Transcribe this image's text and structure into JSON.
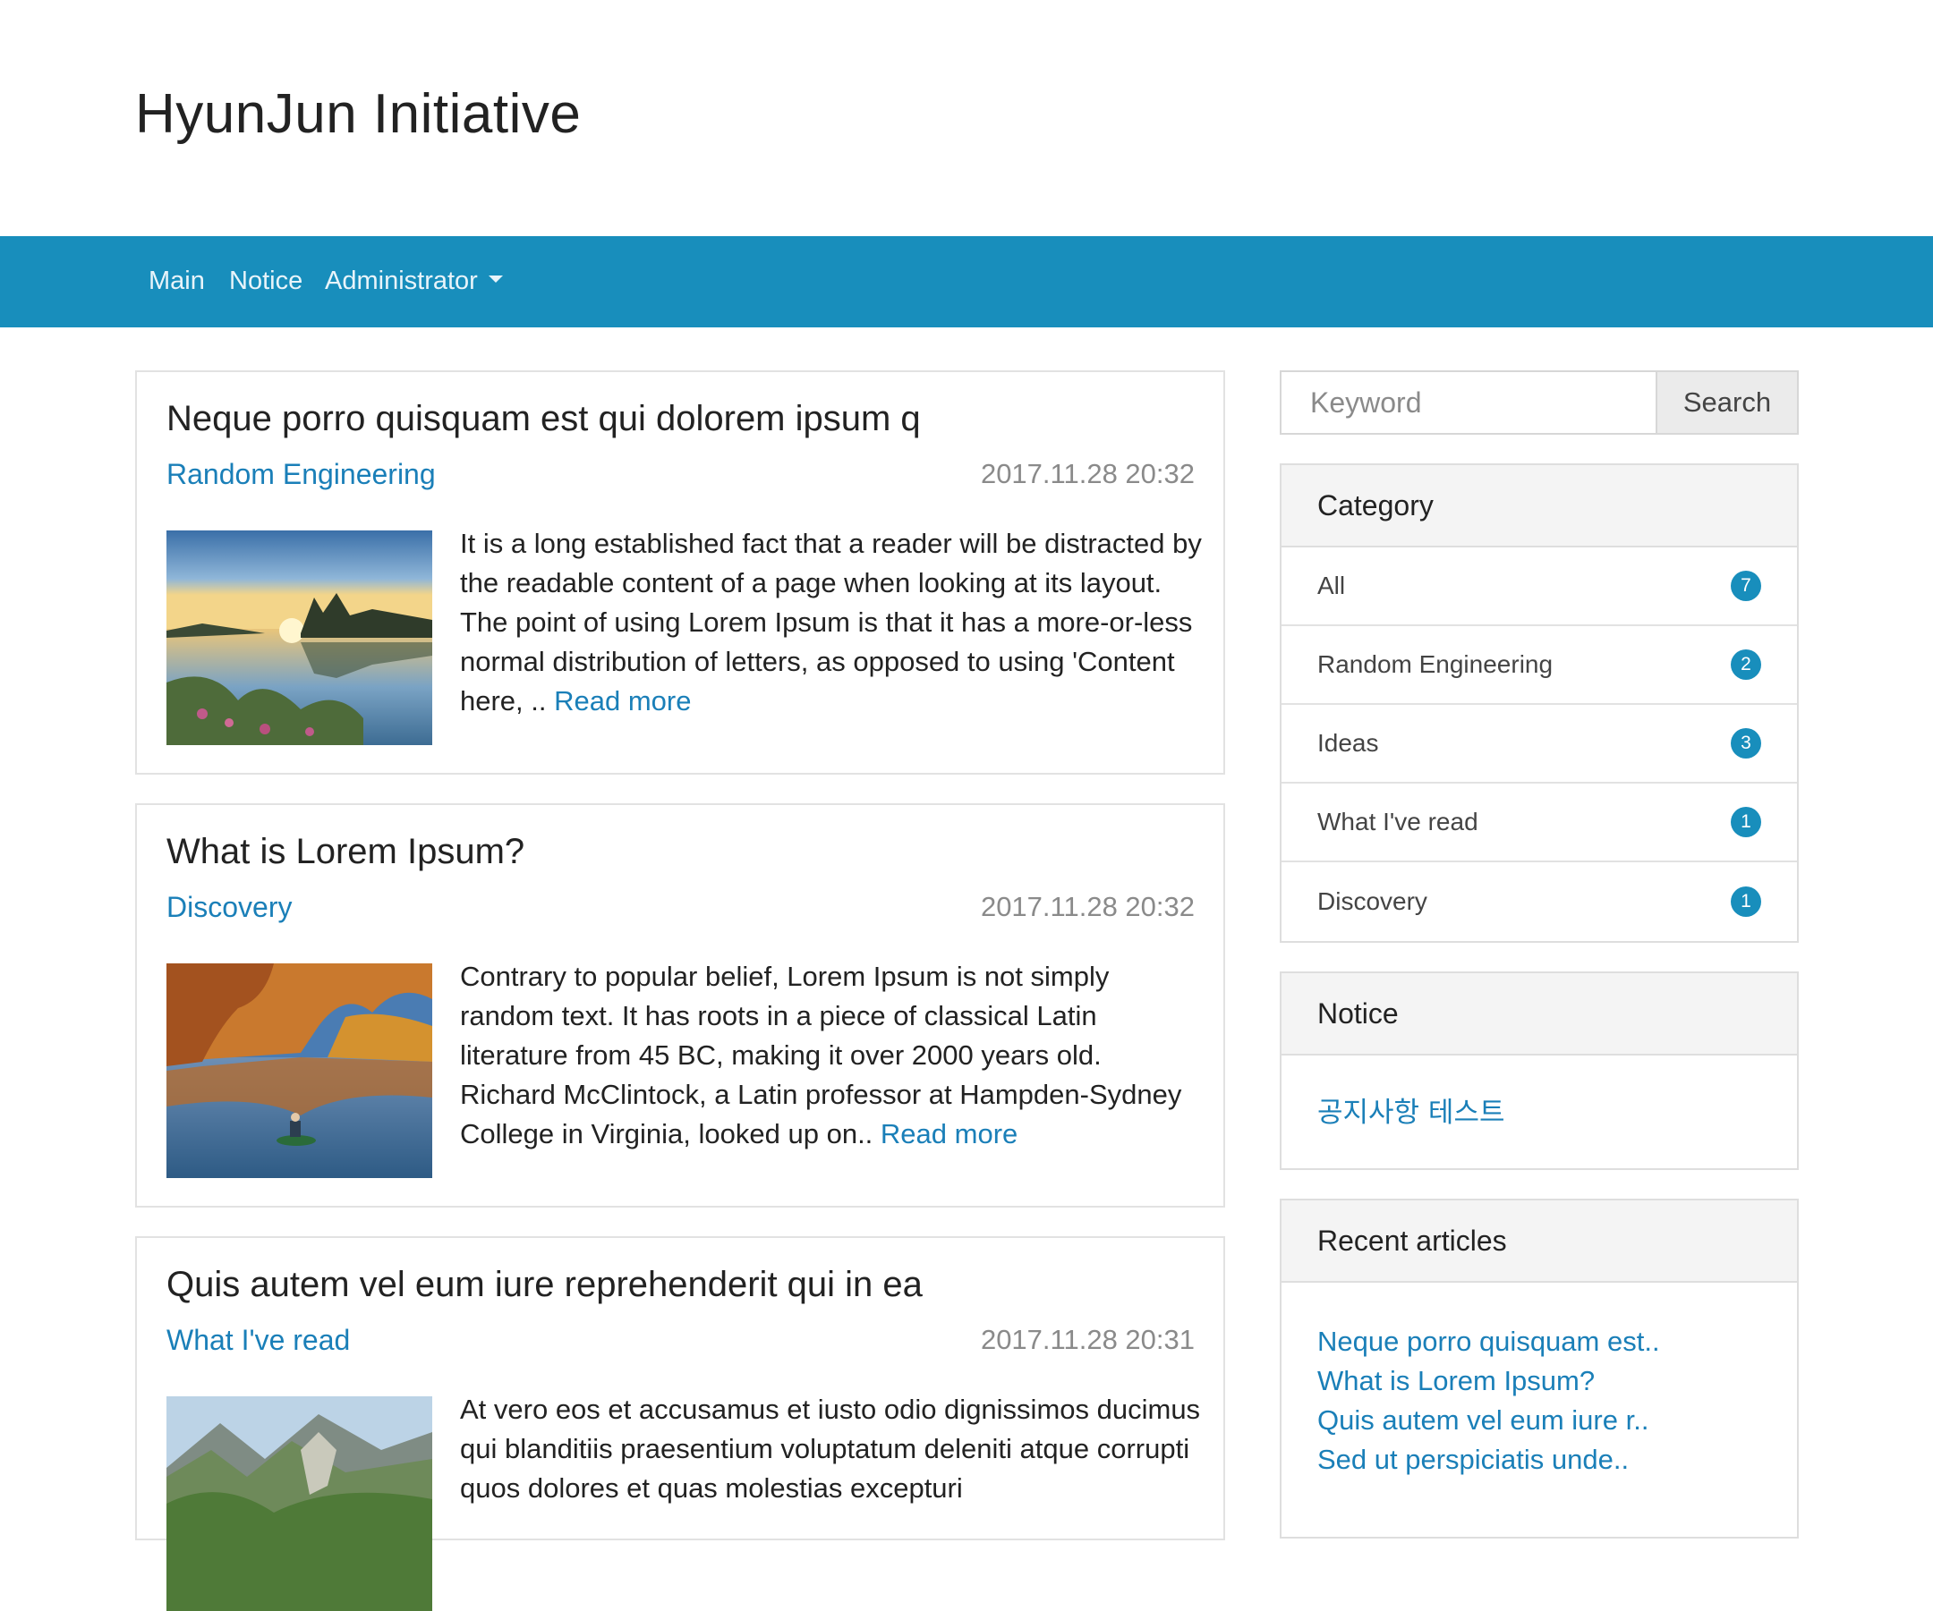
{
  "site": {
    "title": "HyunJun Initiative"
  },
  "nav": {
    "main": "Main",
    "notice": "Notice",
    "admin": "Administrator"
  },
  "posts": [
    {
      "title": "Neque porro quisquam est qui dolorem ipsum q",
      "category": "Random Engineering",
      "date": "2017.11.28 20:32",
      "excerpt": "It is a long established fact that a reader will be distracted by the readable content of a page when looking at its layout. The point of using Lorem Ipsum is that it has a more-or-less normal distribution of letters, as opposed to using 'Content here, .. ",
      "read_more": "Read more"
    },
    {
      "title": "What is Lorem Ipsum?",
      "category": "Discovery",
      "date": "2017.11.28 20:32",
      "excerpt": "Contrary to popular belief, Lorem Ipsum is not simply random text. It has roots in a piece of classical Latin literature from 45 BC, making it over 2000 years old. Richard McClintock, a Latin professor at Hampden-Sydney College in Virginia, looked up on.. ",
      "read_more": "Read more"
    },
    {
      "title": "Quis autem vel eum iure reprehenderit qui in ea",
      "category": "What I've read",
      "date": "2017.11.28 20:31",
      "excerpt": "At vero eos et accusamus et iusto odio dignissimos ducimus qui blanditiis praesentium voluptatum deleniti atque corrupti quos dolores et quas molestias excepturi",
      "read_more": ""
    }
  ],
  "search": {
    "placeholder": "Keyword",
    "button": "Search"
  },
  "category": {
    "title": "Category",
    "items": [
      {
        "label": "All",
        "count": "7"
      },
      {
        "label": "Random Engineering",
        "count": "2"
      },
      {
        "label": "Ideas",
        "count": "3"
      },
      {
        "label": "What I've read",
        "count": "1"
      },
      {
        "label": "Discovery",
        "count": "1"
      }
    ]
  },
  "notice": {
    "title": "Notice",
    "link": "공지사항 테스트"
  },
  "recent": {
    "title": "Recent articles",
    "items": [
      "Neque porro quisquam est..",
      "What is Lorem Ipsum?",
      "Quis autem vel eum iure r..",
      "Sed ut perspiciatis unde.."
    ]
  },
  "colors": {
    "nav_bg": "#188ebc",
    "link": "#1a7fb8",
    "badge": "#188ebc"
  }
}
